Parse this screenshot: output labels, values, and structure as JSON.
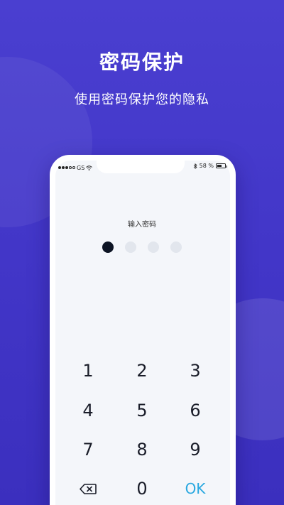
{
  "hero": {
    "title": "密码保护",
    "subtitle": "使用密码保护您的隐私"
  },
  "status_bar": {
    "carrier": "GS",
    "battery_percent": "58 %",
    "battery_level": 0.58,
    "signal_strength": 3,
    "signal_total": 5
  },
  "lock": {
    "prompt": "输入密码",
    "pin_length": 4,
    "entered_count": 1
  },
  "keypad": {
    "keys": [
      "1",
      "2",
      "3",
      "4",
      "5",
      "6",
      "7",
      "8",
      "9",
      "⌫",
      "0",
      "OK"
    ]
  },
  "colors": {
    "background": "#4a3fd0",
    "ok_accent": "#2aa8e0",
    "dot_filled": "#0d1424",
    "dot_empty": "#e2e6ed"
  },
  "icons": [
    "wifi-icon",
    "bluetooth-icon",
    "battery-icon",
    "backspace-icon"
  ]
}
